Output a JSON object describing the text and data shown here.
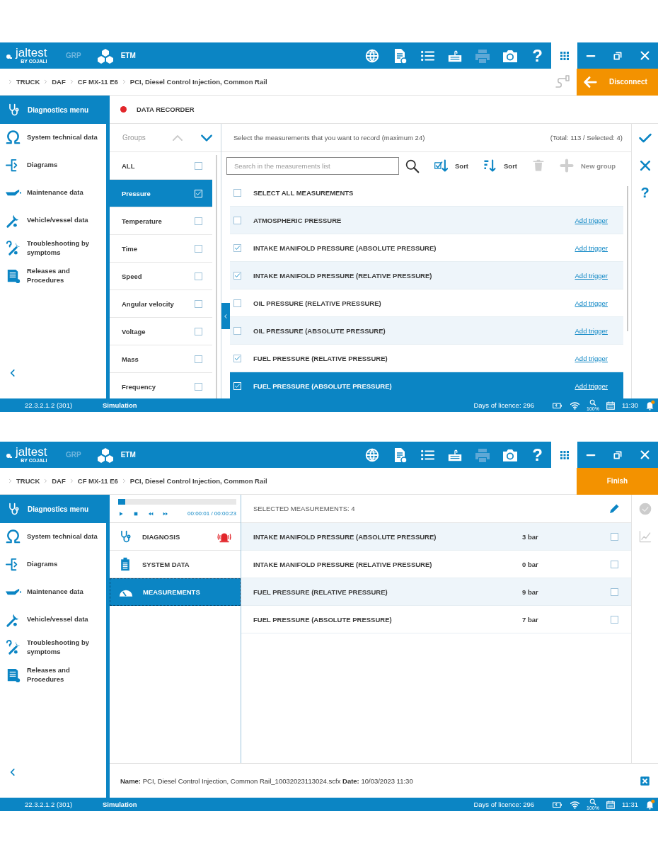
{
  "screens": [
    {
      "kind": "setup",
      "app_bar": {
        "logo": "jaltest",
        "logo_sub": "BY COJALI",
        "modes": [
          {
            "label": "GRP",
            "selected": false
          },
          {
            "label": "ETM",
            "selected": true
          }
        ],
        "help": "?"
      },
      "breadcrumb": [
        "TRUCK",
        "DAF",
        "CF MX-11 E6",
        "PCI, Diesel Control Injection, Common Rail"
      ],
      "action_button": {
        "label": "Disconnect",
        "kind": "back"
      },
      "sidebar": {
        "title": "Diagnostics menu",
        "items": [
          "System technical data",
          "Diagrams",
          "Maintenance data",
          "Vehicle/vessel data",
          "Troubleshooting by symptoms",
          "Releases and Procedures"
        ]
      },
      "title": "DATA RECORDER",
      "groups": {
        "label": "Groups",
        "items": [
          {
            "label": "ALL",
            "selected": false,
            "checked": false
          },
          {
            "label": "Pressure",
            "selected": true,
            "checked": true
          },
          {
            "label": "Temperature",
            "selected": false,
            "checked": false
          },
          {
            "label": "Time",
            "selected": false,
            "checked": false
          },
          {
            "label": "Speed",
            "selected": false,
            "checked": false
          },
          {
            "label": "Angular velocity",
            "selected": false,
            "checked": false
          },
          {
            "label": "Voltage",
            "selected": false,
            "checked": false
          },
          {
            "label": "Mass",
            "selected": false,
            "checked": false
          },
          {
            "label": "Frequency",
            "selected": false,
            "checked": false
          }
        ]
      },
      "instruction": "Select the measurements that you want to record (maximum 24)",
      "totals": "(Total: 113 / Selected: 4)",
      "search": {
        "placeholder": "Search in the measurements list"
      },
      "tools": [
        {
          "kind": "sort-checked",
          "label": "Sort",
          "disabled": false
        },
        {
          "kind": "sort-az",
          "label": "Sort",
          "disabled": false
        },
        {
          "kind": "delete",
          "disabled": true
        },
        {
          "kind": "add",
          "label": "New group",
          "disabled": true
        }
      ],
      "select_all": {
        "label": "SELECT ALL MEASUREMENTS",
        "checked": false
      },
      "measurements": [
        {
          "name": "ATMOSPHERIC PRESSURE",
          "checked": false,
          "selected": false,
          "link": "Add trigger"
        },
        {
          "name": "INTAKE MANIFOLD PRESSURE (ABSOLUTE PRESSURE)",
          "checked": true,
          "selected": false,
          "link": "Add trigger"
        },
        {
          "name": "INTAKE MANIFOLD PRESSURE (RELATIVE PRESSURE)",
          "checked": true,
          "selected": false,
          "link": "Add trigger"
        },
        {
          "name": "OIL PRESSURE (RELATIVE PRESSURE)",
          "checked": false,
          "selected": false,
          "link": "Add trigger"
        },
        {
          "name": "OIL PRESSURE (ABSOLUTE PRESSURE)",
          "checked": false,
          "selected": false,
          "link": "Add trigger"
        },
        {
          "name": "FUEL PRESSURE (RELATIVE PRESSURE)",
          "checked": true,
          "selected": false,
          "link": "Add trigger"
        },
        {
          "name": "FUEL PRESSURE (ABSOLUTE PRESSURE)",
          "checked": true,
          "selected": true,
          "link": "Add trigger"
        }
      ],
      "help": "?",
      "status_bar": {
        "version": "22.3.2.1.2 (301)",
        "mode": "Simulation",
        "licence": "Days of licence: 296",
        "zoom": "100%",
        "time": "11:30"
      }
    },
    {
      "kind": "playback",
      "app_bar": {
        "logo": "jaltest",
        "logo_sub": "BY COJALI",
        "modes": [
          {
            "label": "GRP",
            "selected": false
          },
          {
            "label": "ETM",
            "selected": true
          }
        ],
        "help": "?"
      },
      "breadcrumb": [
        "TRUCK",
        "DAF",
        "CF MX-11 E6",
        "PCI, Diesel Control Injection, Common Rail"
      ],
      "action_button": {
        "label": "Finish",
        "kind": "plain"
      },
      "sidebar": {
        "title": "Diagnostics menu",
        "items": [
          "System technical data",
          "Diagrams",
          "Maintenance data",
          "Vehicle/vessel data",
          "Troubleshooting by symptoms",
          "Releases and Procedures"
        ]
      },
      "player": {
        "level": 0.06,
        "time": "00:00:01 / 00:00:23"
      },
      "menu": [
        {
          "label": "DIAGNOSIS",
          "selected": false,
          "alert": true
        },
        {
          "label": "SYSTEM DATA",
          "selected": false,
          "alert": false
        },
        {
          "label": "MEASUREMENTS",
          "selected": true,
          "alert": false
        }
      ],
      "selected_header": "SELECTED MEASUREMENTS: 4",
      "readings": [
        {
          "name": "INTAKE MANIFOLD PRESSURE (ABSOLUTE PRESSURE)",
          "value": "3 bar",
          "checked": false
        },
        {
          "name": "INTAKE MANIFOLD PRESSURE (RELATIVE PRESSURE)",
          "value": "0 bar",
          "checked": false
        },
        {
          "name": "FUEL PRESSURE (RELATIVE PRESSURE)",
          "value": "9 bar",
          "checked": false
        },
        {
          "name": "FUEL PRESSURE (ABSOLUTE PRESSURE)",
          "value": "7 bar",
          "checked": false
        }
      ],
      "file_info": "**Name:** PCI, Diesel Control Injection, Common Rail_10032023113024.scfx  **Date:** 10/03/2023 11:30",
      "status_bar": {
        "version": "22.3.2.1.2 (301)",
        "mode": "Simulation",
        "licence": "Days of licence: 296",
        "zoom": "100%",
        "time": "11:31"
      }
    }
  ]
}
